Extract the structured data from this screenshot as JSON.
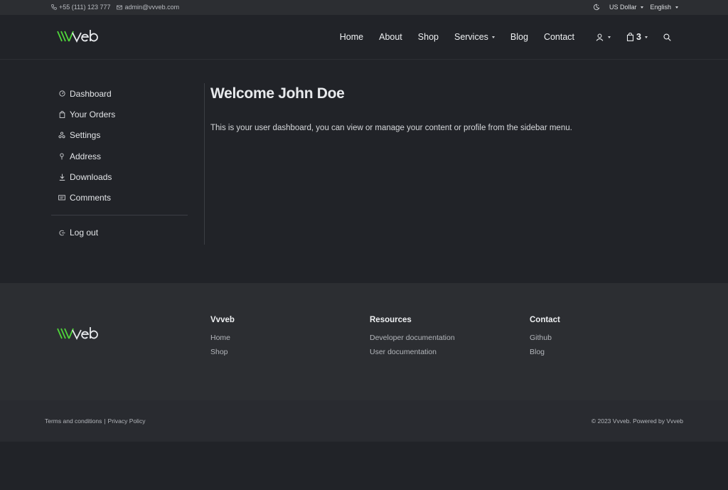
{
  "topbar": {
    "phone": "+55 (111) 123 777",
    "email": "admin@vvveb.com",
    "currency": "US Dollar",
    "language": "English"
  },
  "brand": {
    "logo_text": "vvveb",
    "accent": "#4fd63a"
  },
  "nav": {
    "items": [
      "Home",
      "About",
      "Shop",
      "Services",
      "Blog",
      "Contact"
    ],
    "cart_count": "3"
  },
  "sidebar": {
    "items": [
      "Dashboard",
      "Your Orders",
      "Settings",
      "Address",
      "Downloads",
      "Comments"
    ],
    "logout": "Log out"
  },
  "content": {
    "welcome": "Welcome",
    "user_name": "John Doe",
    "description": "This is your user dashboard, you can view or manage your content or profile from the sidebar menu."
  },
  "footer": {
    "columns": [
      {
        "title": "Vvveb",
        "links": [
          "Home",
          "Shop"
        ]
      },
      {
        "title": "Resources",
        "links": [
          "Developer documentation",
          "User documentation"
        ]
      },
      {
        "title": "Contact",
        "links": [
          "Github",
          "Blog"
        ]
      }
    ]
  },
  "bottombar": {
    "terms": "Terms and conditions",
    "separator": "|",
    "privacy": "Privacy Policy",
    "copyright": "© 2023 Vvveb. Powered by Vvveb"
  }
}
